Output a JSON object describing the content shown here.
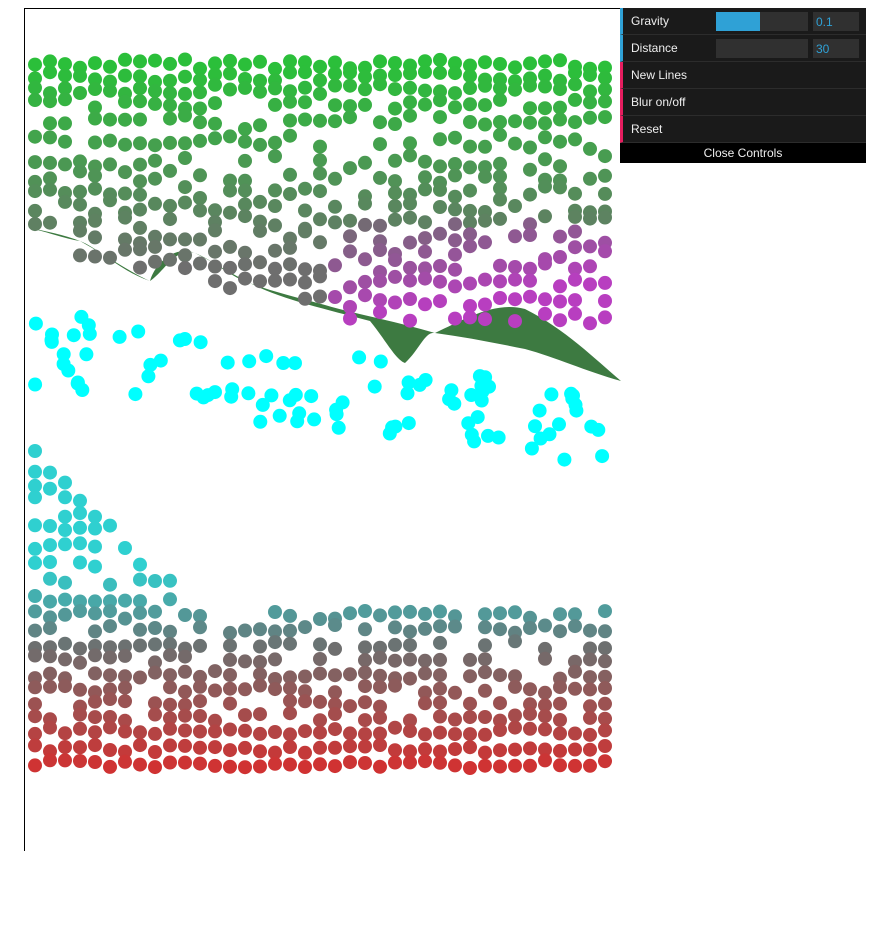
{
  "controls": {
    "gravity": {
      "label": "Gravity",
      "value": "0.1",
      "fraction": 0.48
    },
    "distance": {
      "label": "Distance",
      "value": "30",
      "fraction": 0.0
    },
    "new_lines": {
      "label": "New Lines"
    },
    "blur": {
      "label": "Blur on/off"
    },
    "reset": {
      "label": "Reset"
    },
    "close": {
      "label": "Close Controls"
    }
  },
  "colors": {
    "slider_accent": "#2fa1d6",
    "function_accent": "#e61d5f",
    "panel_bg": "#1a1a1a",
    "band": "#3d7a41",
    "green_dots": "#2bbf3a",
    "cyan_dots": "#00ffff",
    "purple_dots": "#b83ec0",
    "red_dots": "#d23131",
    "gray_mid": "#6e6e6e"
  }
}
